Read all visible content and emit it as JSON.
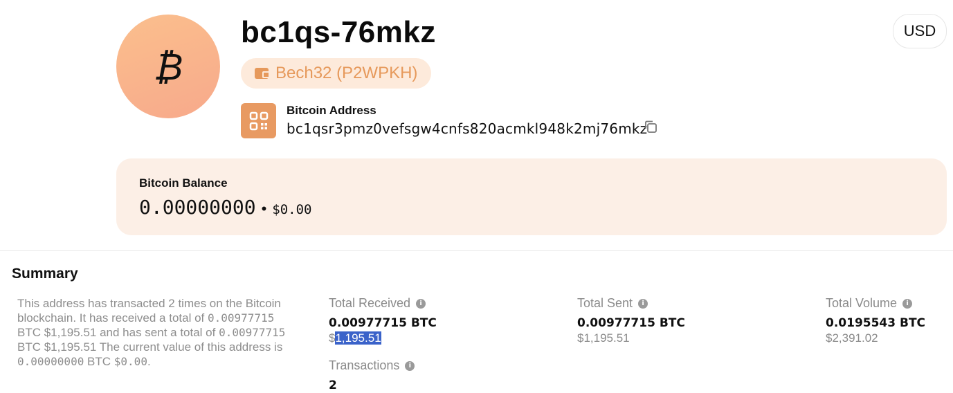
{
  "header": {
    "avatar_symbol": "₿",
    "title": "bc1qs-76mkz",
    "address_type": "Bech32 (P2WPKH)",
    "currency_button": "USD"
  },
  "address": {
    "label": "Bitcoin Address",
    "value": "bc1qsr3pmz0vefsgw4cnfs820acmkl948k2mj76mkz"
  },
  "balance": {
    "label": "Bitcoin Balance",
    "btc": "0.00000000",
    "separator": "•",
    "usd": "$0.00"
  },
  "summary": {
    "title": "Summary",
    "text_parts": {
      "p1": "This address has transacted 2 times on the Bitcoin blockchain. It has received a total of ",
      "p2": "0.00977715",
      "p3": " BTC $1,195.51 and has sent a total of ",
      "p4": "0.00977715",
      "p5": " BTC $1,195.51 The current value of this address is ",
      "p6": "0.00000000",
      "p7": " BTC ",
      "p8": "$0.00",
      "p9": "."
    },
    "total_received": {
      "label": "Total Received",
      "btc": "0.00977715 BTC",
      "usd_prefix": "$",
      "usd_value": "1,195.51"
    },
    "total_sent": {
      "label": "Total Sent",
      "btc": "0.00977715 BTC",
      "usd": "$1,195.51"
    },
    "total_volume": {
      "label": "Total Volume",
      "btc": "0.0195543 BTC",
      "usd": "$2,391.02"
    },
    "transactions": {
      "label": "Transactions",
      "value": "2"
    }
  },
  "colors": {
    "accent": "#e89a62",
    "pill_bg": "#fdeadb",
    "card_bg": "#fcefe6",
    "selection": "#3a62c9"
  },
  "icons": {
    "avatar": "bitcoin-icon",
    "pill": "wallet-icon",
    "address": "qr-code-icon",
    "copy": "copy-icon",
    "info": "info-icon"
  }
}
